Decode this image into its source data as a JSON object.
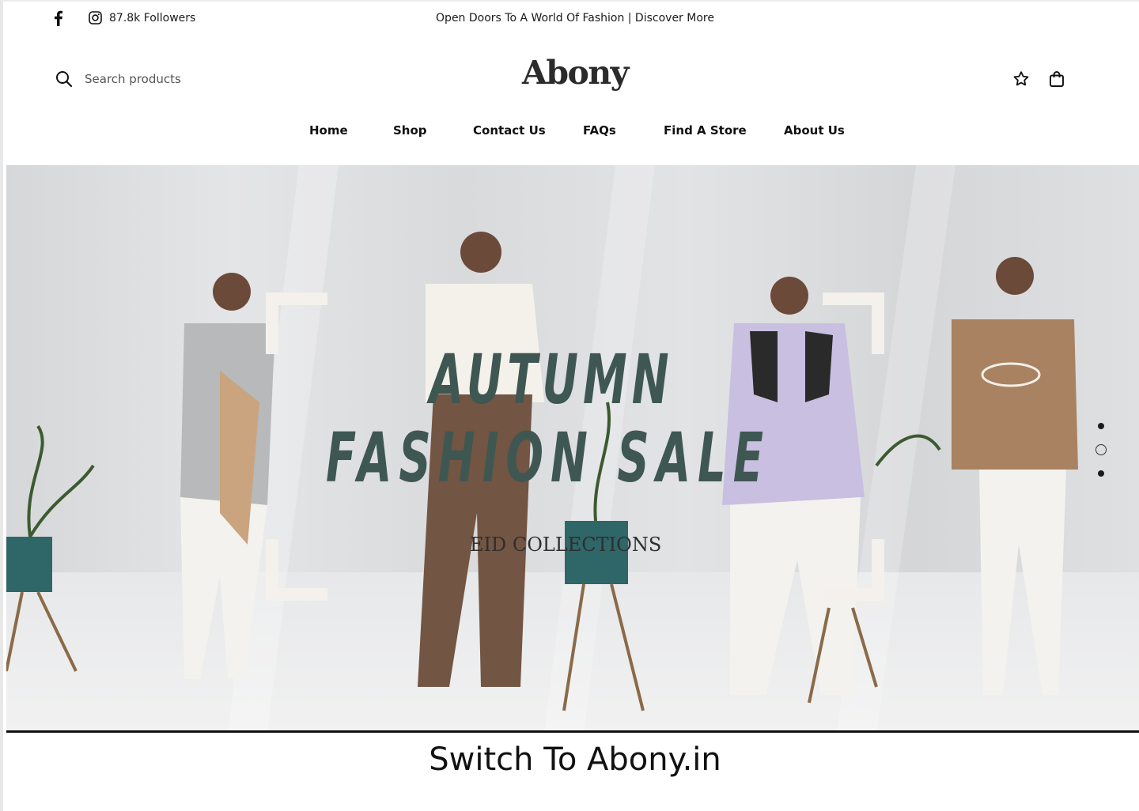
{
  "topbar": {
    "facebook_icon": "facebook-icon",
    "instagram_icon": "instagram-icon",
    "followers": "87.8k Followers",
    "announcement": "Open Doors To A World Of Fashion | Discover More"
  },
  "header": {
    "search_placeholder": "Search products",
    "logo": "Abony",
    "wishlist_icon": "star-icon",
    "cart_icon": "shopping-bag-icon"
  },
  "nav": {
    "items": [
      "Home",
      "Shop",
      "Contact Us",
      "FAQs",
      "Find A Store",
      "About Us"
    ]
  },
  "hero": {
    "headline_line1": "AUTUMN",
    "headline_line2": "FASHION SALE",
    "subtitle": "EID COLLECTIONS",
    "slides_total": 3,
    "active_slide": 2
  },
  "footer_banner": {
    "text": "Switch To Abony.in"
  },
  "colors": {
    "headline": "#3f5752",
    "bracket": "#f4f1ec",
    "text": "#111111"
  }
}
